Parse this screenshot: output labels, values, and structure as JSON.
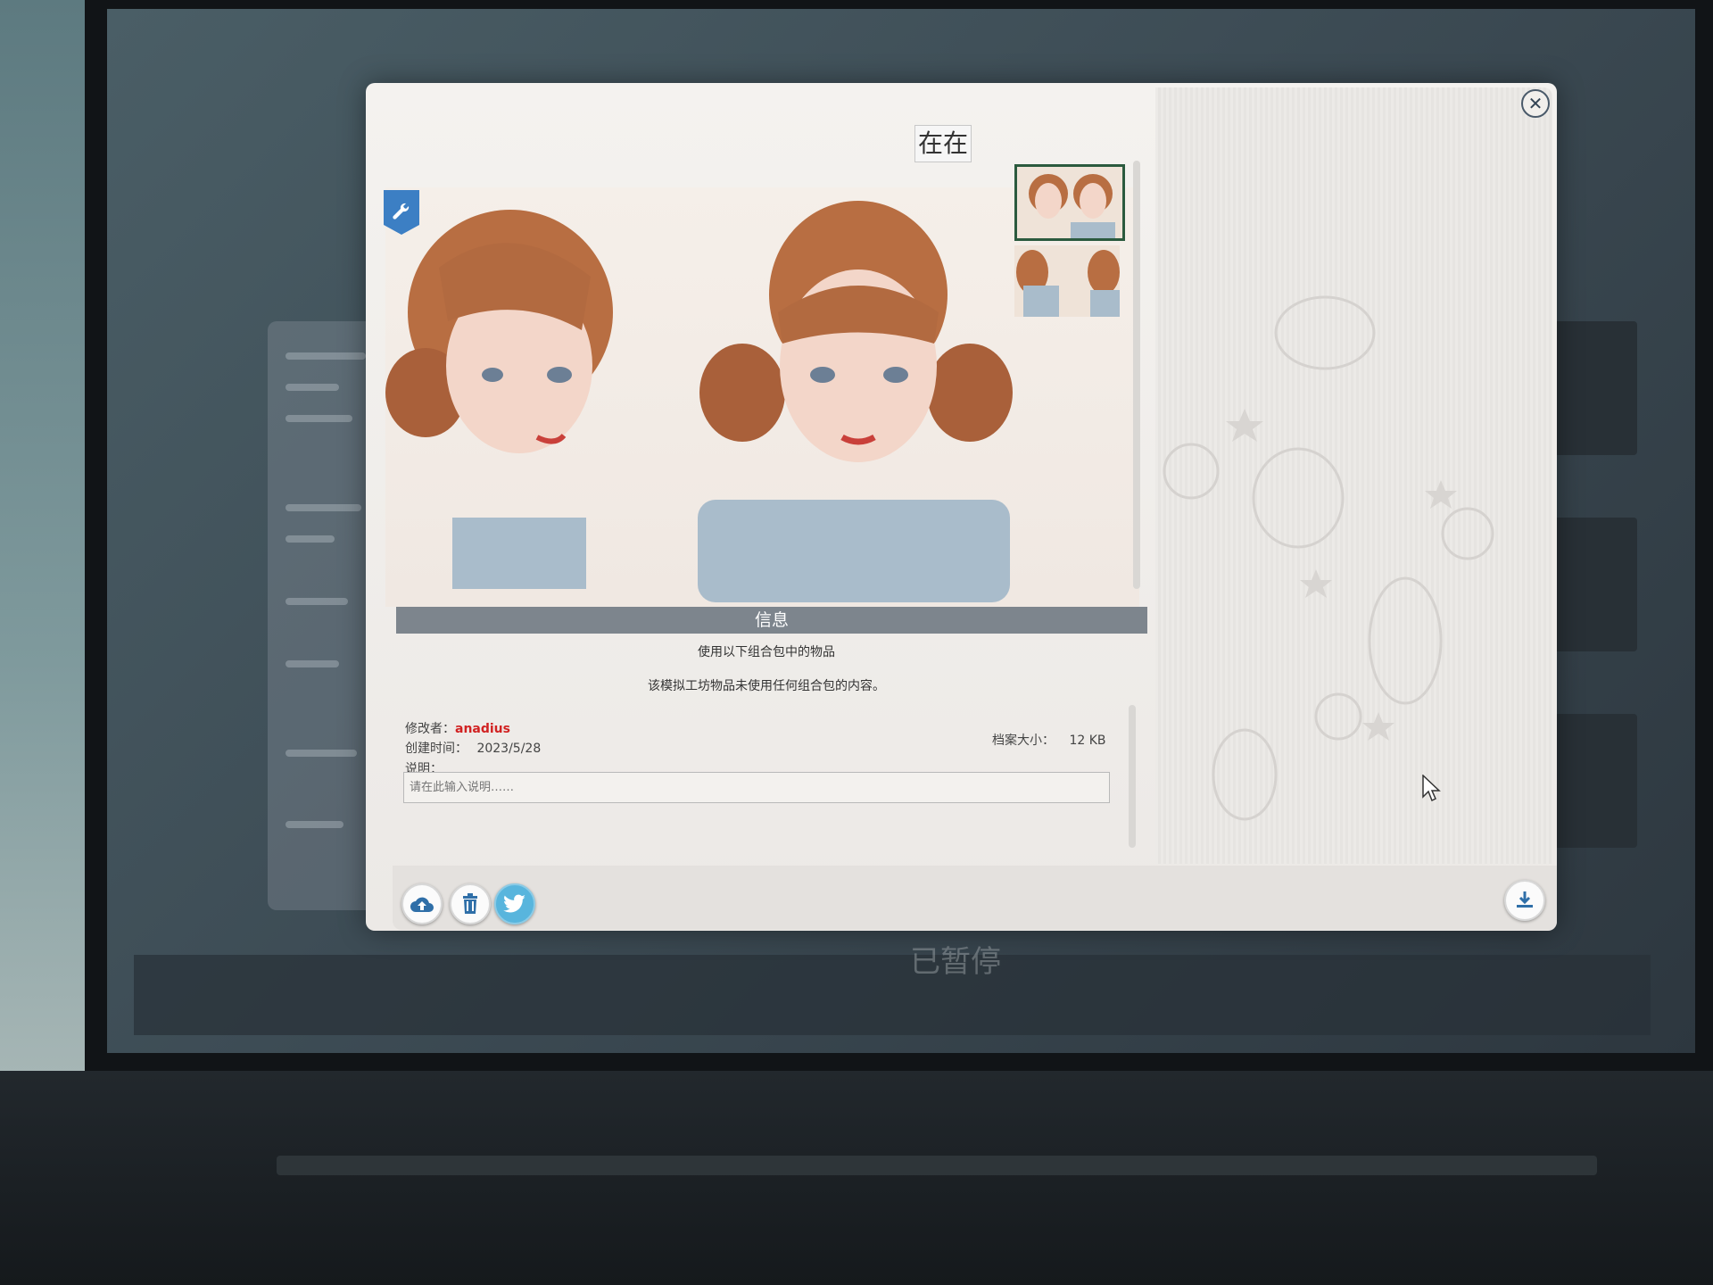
{
  "dialog": {
    "title": "在在",
    "close_label": "✕"
  },
  "info": {
    "header": "信息",
    "pack_notice": "使用以下组合包中的物品",
    "pack_detail": "该模拟工坊物品未使用任何组合包的内容。",
    "modifier_label": "修改者：",
    "modifier_value": "anadius",
    "created_label": "创建时间：",
    "created_value": "2023/5/28",
    "description_label": "说明：",
    "description_placeholder": "请在此输入说明……",
    "filesize_label": "档案大小：",
    "filesize_value": "12 KB"
  },
  "background": {
    "status_text": "已暂停"
  },
  "icons": {
    "wrench": "wrench-icon",
    "upload": "cloud-upload-icon",
    "delete": "trash-icon",
    "share": "twitter-icon",
    "download": "download-icon"
  },
  "colors": {
    "accent_blue": "#3c7fc4",
    "info_bar": "#7d858d",
    "modifier_red": "#d12222",
    "twitter_blue": "#58b5dd"
  }
}
